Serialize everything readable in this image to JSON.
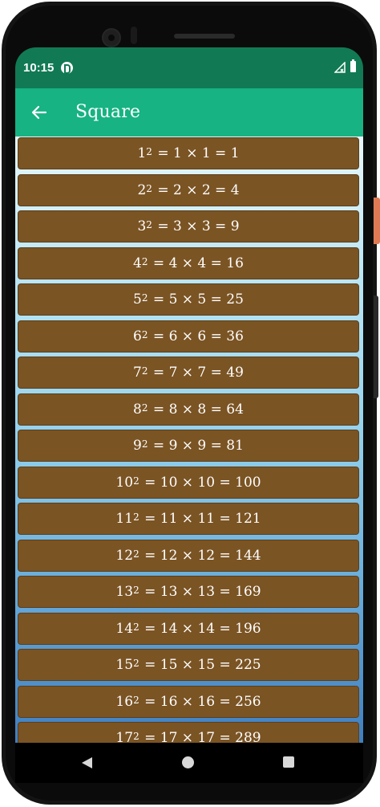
{
  "status_bar": {
    "time": "10:15"
  },
  "app_bar": {
    "title": "Square"
  },
  "rows": [
    {
      "n": "1",
      "exp": "2",
      "expr": " = 1 × 1 = 1"
    },
    {
      "n": "2",
      "exp": "2",
      "expr": " = 2 × 2 = 4"
    },
    {
      "n": "3",
      "exp": "2",
      "expr": " = 3 × 3 = 9"
    },
    {
      "n": "4",
      "exp": "2",
      "expr": " = 4 × 4 = 16"
    },
    {
      "n": "5",
      "exp": "2",
      "expr": " = 5 × 5 = 25"
    },
    {
      "n": "6",
      "exp": "2",
      "expr": " = 6 × 6 = 36"
    },
    {
      "n": "7",
      "exp": "2",
      "expr": " = 7 × 7 = 49"
    },
    {
      "n": "8",
      "exp": "2",
      "expr": " = 8 × 8 = 64"
    },
    {
      "n": "9",
      "exp": "2",
      "expr": " = 9 × 9 = 81"
    },
    {
      "n": "10",
      "exp": "2",
      "expr": " = 10 × 10 = 100"
    },
    {
      "n": "11",
      "exp": "2",
      "expr": " = 11 × 11 = 121"
    },
    {
      "n": "12",
      "exp": "2",
      "expr": " = 12 × 12 = 144"
    },
    {
      "n": "13",
      "exp": "2",
      "expr": " = 13 × 13 = 169"
    },
    {
      "n": "14",
      "exp": "2",
      "expr": " = 14 × 14 = 196"
    },
    {
      "n": "15",
      "exp": "2",
      "expr": " = 15 × 15 = 225"
    },
    {
      "n": "16",
      "exp": "2",
      "expr": " = 16 × 16 = 256"
    },
    {
      "n": "17",
      "exp": "2",
      "expr": " = 17 × 17 = 289"
    }
  ],
  "colors": {
    "status_bar": "#117a54",
    "app_bar": "#17b382",
    "row_background": "#7b5424",
    "row_text": "#ffffff"
  },
  "icons": {
    "back": "arrow-left-icon",
    "nav_back": "triangle-back-icon",
    "nav_home": "circle-home-icon",
    "nav_recents": "square-recents-icon"
  }
}
